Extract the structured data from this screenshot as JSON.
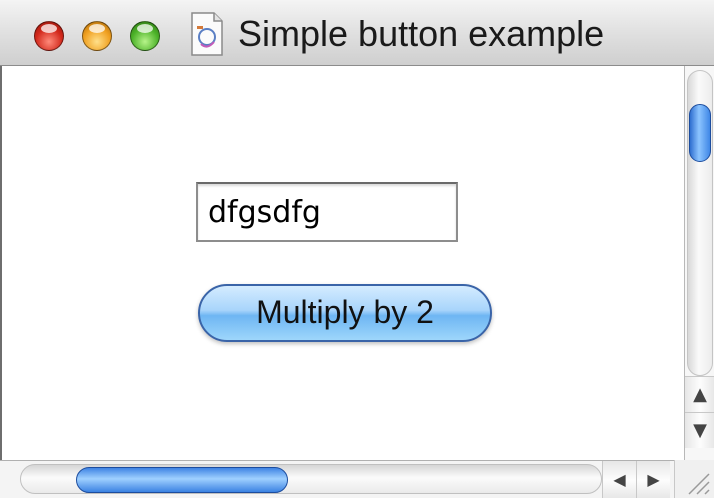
{
  "window": {
    "title": "Simple button example"
  },
  "main": {
    "text_field_value": "dfgsdfg",
    "button_label": "Multiply by 2"
  },
  "icons": {
    "close": "close-button",
    "minimize": "minimize-button",
    "zoom": "zoom-button",
    "document": "document-icon",
    "scroll_up": "arrow-up-icon",
    "scroll_down": "arrow-down-icon",
    "scroll_left": "arrow-left-icon",
    "scroll_right": "arrow-right-icon",
    "resize": "resize-grip-icon"
  },
  "colors": {
    "button_accent": "#8cc4ff",
    "scroll_thumb": "#3f87e6"
  }
}
